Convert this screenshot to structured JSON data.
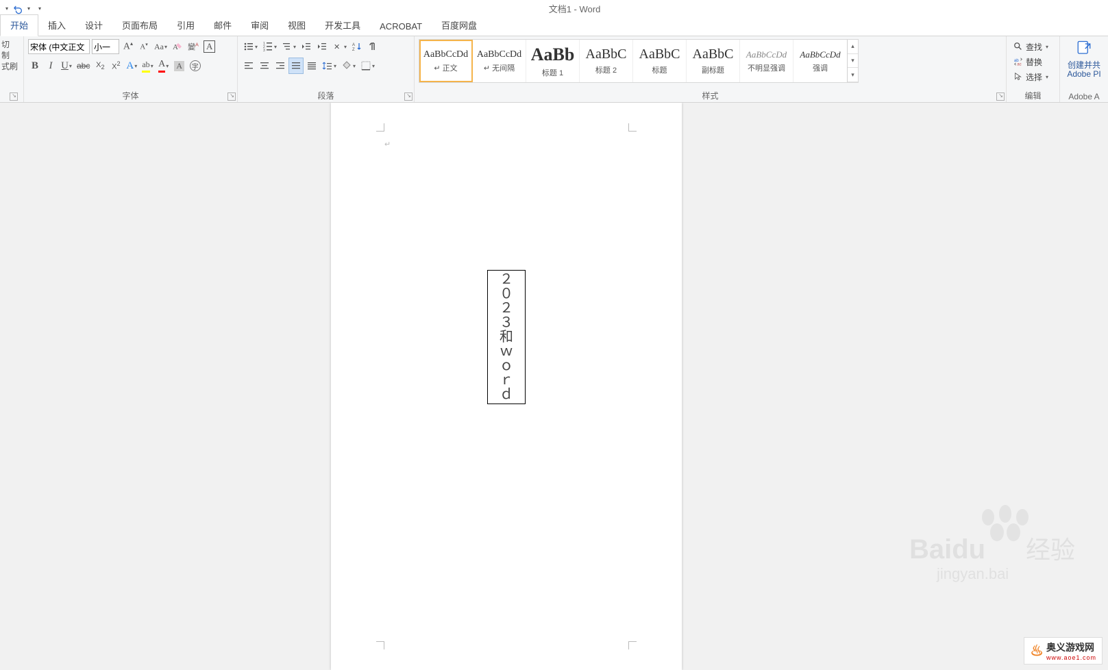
{
  "title": "文档1 - Word",
  "tabs": [
    "开始",
    "插入",
    "设计",
    "页面布局",
    "引用",
    "邮件",
    "审阅",
    "视图",
    "开发工具",
    "ACROBAT",
    "百度网盘"
  ],
  "active_tab_index": 0,
  "clipboard": {
    "cut": "切",
    "copy": "制",
    "painter": "式刷"
  },
  "font": {
    "name_value": "宋体 (中文正文",
    "size_value": "小一",
    "group_label": "字体"
  },
  "paragraph": {
    "group_label": "段落"
  },
  "styles": {
    "group_label": "样式",
    "items": [
      {
        "sample": "AaBbCcDd",
        "name": "↵ 正文",
        "size": "14px",
        "color": "#333"
      },
      {
        "sample": "AaBbCcDd",
        "name": "↵ 无间隔",
        "size": "14px",
        "color": "#333"
      },
      {
        "sample": "AaBb",
        "name": "标题 1",
        "size": "26px",
        "color": "#000",
        "weight": "bold"
      },
      {
        "sample": "AaBbC",
        "name": "标题 2",
        "size": "20px",
        "color": "#333"
      },
      {
        "sample": "AaBbC",
        "name": "标题",
        "size": "20px",
        "color": "#333"
      },
      {
        "sample": "AaBbC",
        "name": "副标题",
        "size": "20px",
        "color": "#333"
      },
      {
        "sample": "AaBbCcDd",
        "name": "不明显强调",
        "size": "13px",
        "color": "#888",
        "italic": true
      },
      {
        "sample": "AaBbCcDd",
        "name": "强调",
        "size": "13px",
        "color": "#555",
        "italic": true
      }
    ]
  },
  "editing": {
    "group_label": "编辑",
    "find": "查找",
    "replace": "替换",
    "select": "选择"
  },
  "adobe": {
    "label1": "创建并共",
    "label2": "Adobe PI",
    "group_label": "Adobe A"
  },
  "document": {
    "textbox_content": "２０２３和ｗｏｒｄ"
  },
  "watermark": {
    "brand": "Baidu",
    "sub": "经验",
    "url": "jingyan.bai"
  },
  "corner": {
    "text": "奥义游戏网",
    "url": "www.aoe1.com"
  }
}
